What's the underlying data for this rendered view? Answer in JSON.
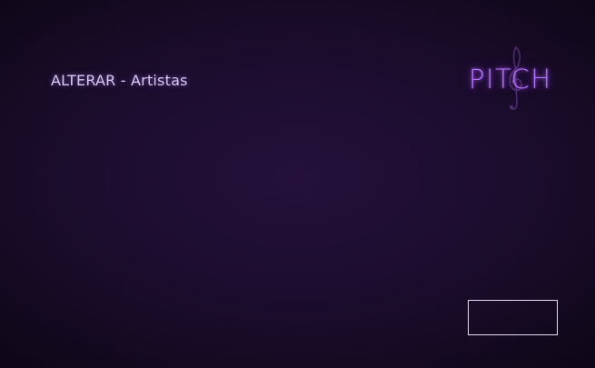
{
  "header": {
    "title": "ALTERAR - Artistas"
  },
  "brand": {
    "logo_text": "PITCH",
    "logo_icon": "treble-clef-icon"
  },
  "footer": {
    "action_button_label": ""
  },
  "colors": {
    "background": "#1d0d30",
    "accent": "#b56dff",
    "title_text": "#d9c8f5",
    "button_border": "#e6dcf5"
  }
}
